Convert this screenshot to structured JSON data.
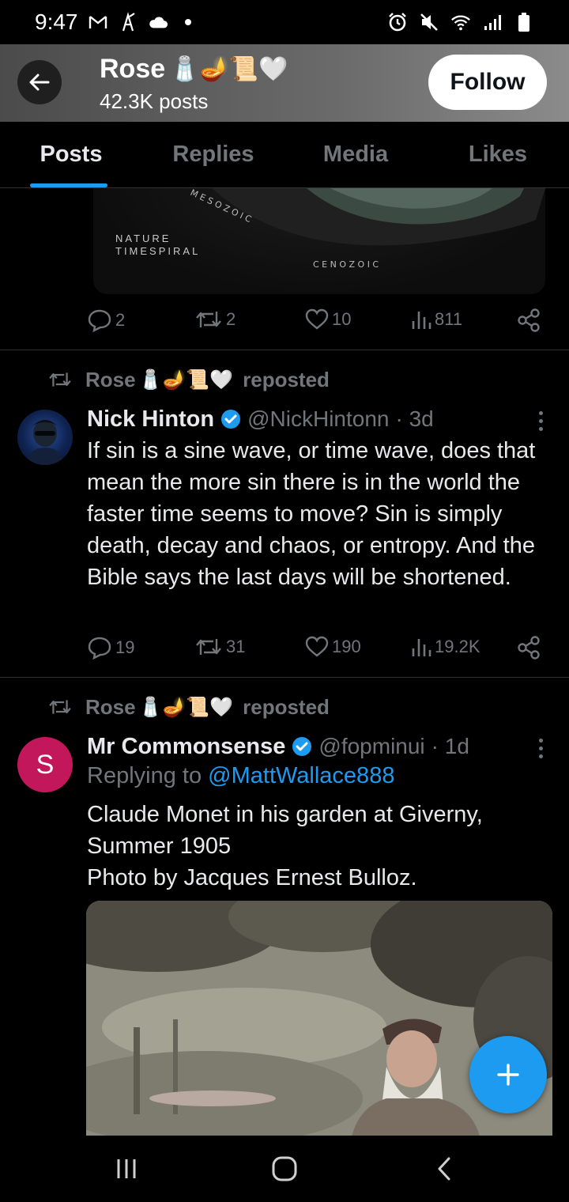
{
  "status_bar": {
    "time": "9:47",
    "left_icons": [
      "gmail-icon",
      "app-icon",
      "cloud-icon",
      "dot-icon"
    ],
    "right_icons": [
      "alarm-icon",
      "mute-icon",
      "wifi-icon",
      "signal-icon",
      "battery-icon"
    ]
  },
  "header": {
    "name": "Rose",
    "name_emojis": "🧂🪔📜🤍",
    "posts_count": "42.3K posts",
    "follow_label": "Follow"
  },
  "tabs": [
    {
      "label": "Posts",
      "active": true
    },
    {
      "label": "Replies",
      "active": false
    },
    {
      "label": "Media",
      "active": false
    },
    {
      "label": "Likes",
      "active": false
    }
  ],
  "prev_post": {
    "image_caption_line1": "NATURE",
    "image_caption_line2": "TIMESPIRAL",
    "era_mesozoic": "M E S O Z O I C",
    "era_cenozoic": "C E N O Z O I C",
    "replies": "2",
    "reposts": "2",
    "likes": "10",
    "views": "811"
  },
  "post1": {
    "repost_user": "Rose",
    "repost_emojis": "🧂🪔📜🤍",
    "repost_label": "reposted",
    "author": "Nick Hinton",
    "handle": "@NickHintonn",
    "time": "· 3d",
    "text": "If sin is a sine wave, or time wave, does that mean the more sin there is in the world the faster time seems to move? Sin is simply death, decay and chaos, or entropy. And the Bible says the last days will be shortened.",
    "replies": "19",
    "reposts": "31",
    "likes": "190",
    "views": "19.2K"
  },
  "post2": {
    "repost_user": "Rose",
    "repost_emojis": "🧂🪔📜🤍",
    "repost_label": "reposted",
    "avatar_letter": "S",
    "author": "Mr Commonsense",
    "handle": "@fopminui",
    "time": "· 1d",
    "replying_prefix": "Replying to ",
    "replying_to": "@MattWallace888",
    "text_line1": "Claude Monet in his garden at Giverny,",
    "text_line2": "Summer 1905",
    "text_line3": "Photo by Jacques Ernest Bulloz."
  },
  "colors": {
    "accent": "#1d9bf0",
    "muted": "#71767b",
    "text": "#e7e9ea",
    "divider": "#2f3336",
    "avatar_s": "#c2185b"
  }
}
